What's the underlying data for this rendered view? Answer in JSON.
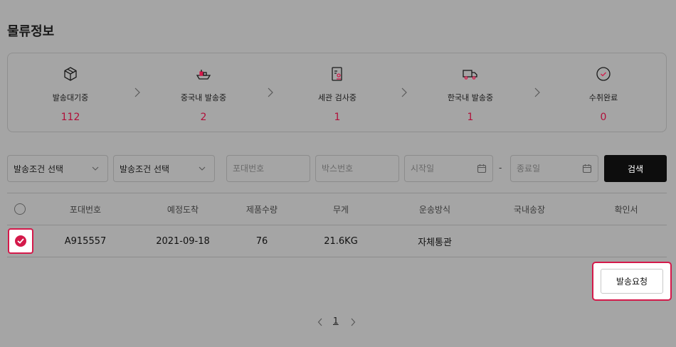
{
  "page": {
    "title": "물류정보"
  },
  "status_steps": [
    {
      "label": "발송대기중",
      "count": "112",
      "icon": "box-icon"
    },
    {
      "label": "중국내 발송중",
      "count": "2",
      "icon": "ship-icon"
    },
    {
      "label": "세관 검사중",
      "count": "1",
      "icon": "customs-document-icon"
    },
    {
      "label": "한국내 발송중",
      "count": "1",
      "icon": "truck-icon"
    },
    {
      "label": "수취완료",
      "count": "0",
      "icon": "check-circle-icon"
    }
  ],
  "filters": {
    "shipping_condition_1": "발송조건 선택",
    "shipping_condition_2": "발송조건 선택",
    "bag_number_placeholder": "포대번호",
    "box_number_placeholder": "박스번호",
    "start_date_placeholder": "시작일",
    "range_separator": "-",
    "end_date_placeholder": "종료일",
    "search_label": "검색"
  },
  "table": {
    "columns": [
      "포대번호",
      "예정도착",
      "제품수량",
      "무게",
      "운송방식",
      "국내송장",
      "확인서"
    ],
    "rows": [
      {
        "bag_number": "A915557",
        "arrival": "2021-09-18",
        "quantity": "76",
        "weight": "21.6KG",
        "method": "자체통관",
        "invoice": "",
        "confirmation": "",
        "selected": true
      }
    ]
  },
  "actions": {
    "request_shipping": "발송요청"
  },
  "pagination": {
    "current": "1"
  },
  "colors": {
    "accent": "#d4194a",
    "count_text": "#b0103a",
    "search_button": "#0d0d0d"
  }
}
